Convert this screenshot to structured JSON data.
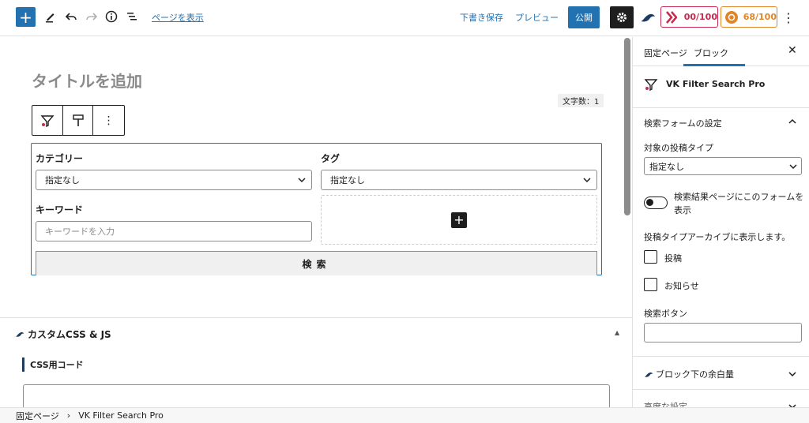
{
  "toolbar": {
    "view_page_link": "ページを表示",
    "save_draft": "下書き保存",
    "preview": "プレビュー",
    "publish": "公開",
    "score_seo": "00/100",
    "score_readability": "68/100"
  },
  "editor": {
    "title_placeholder": "タイトルを追加",
    "char_count": "文字数：1",
    "form": {
      "category_label": "カテゴリー",
      "category_value": "指定なし",
      "tag_label": "タグ",
      "tag_value": "指定なし",
      "keyword_label": "キーワード",
      "keyword_placeholder": "キーワードを入力",
      "search_button": "検索"
    }
  },
  "meta_box": {
    "title": "カスタムCSS & JS",
    "css_label": "CSS用コード"
  },
  "breadcrumb": [
    "固定ページ",
    "VK Filter Search Pro"
  ],
  "breadcrumb_separator": "›",
  "sidebar": {
    "tabs": [
      "固定ページ",
      "ブロック"
    ],
    "active_tab": "ブロック",
    "block_name": "VK Filter Search Pro",
    "panel_form_settings": "検索フォームの設定",
    "post_type_label": "対象の投稿タイプ",
    "post_type_value": "指定なし",
    "toggle_label": "検索結果ページにこのフォームを表示",
    "archive_label": "投稿タイプアーカイブに表示します。",
    "checkbox_posts": "投稿",
    "checkbox_news": "お知らせ",
    "search_button_label": "検索ボタン",
    "panel_margin": "ブロック下の余白量",
    "panel_advanced": "高度な設定"
  },
  "colors": {
    "accent": "#2271b1",
    "score_seo": "#c62a4e",
    "score_readability": "#e0862a"
  }
}
